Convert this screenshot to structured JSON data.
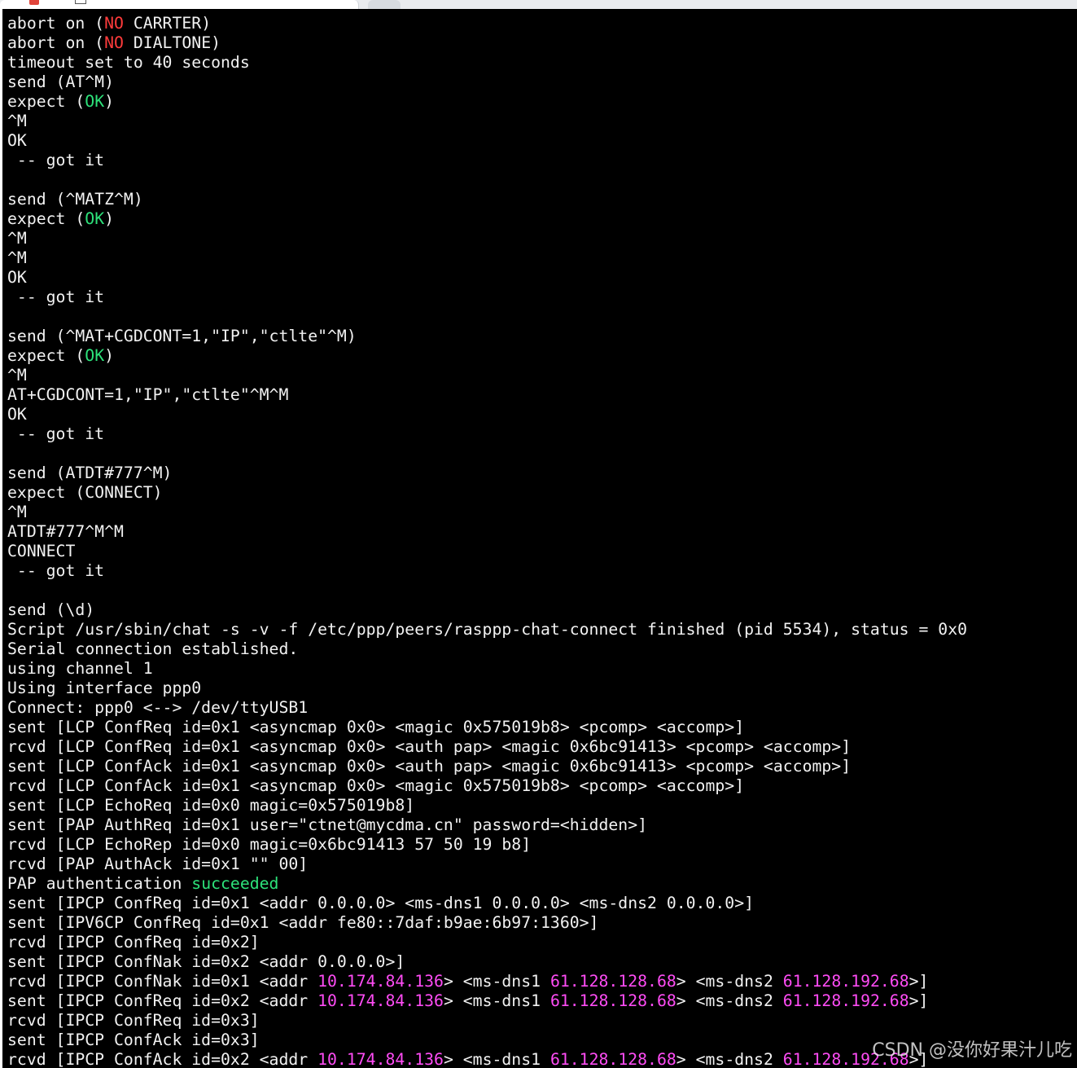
{
  "colors": {
    "terminal_bg": "#000000",
    "text": "#f2f2f2",
    "red": "#ff3b3b",
    "green": "#2de27a",
    "magenta": "#ff4cf5"
  },
  "terminal": {
    "lines": [
      [
        {
          "t": "abort on ("
        },
        {
          "t": "NO",
          "c": "red"
        },
        {
          "t": " CARRTER)"
        }
      ],
      [
        {
          "t": "abort on ("
        },
        {
          "t": "NO",
          "c": "red"
        },
        {
          "t": " DIALTONE)"
        }
      ],
      [
        {
          "t": "timeout set to 40 seconds"
        }
      ],
      [
        {
          "t": "send (AT^M)"
        }
      ],
      [
        {
          "t": "expect ("
        },
        {
          "t": "OK",
          "c": "green"
        },
        {
          "t": ")"
        }
      ],
      [
        {
          "t": "^M"
        }
      ],
      [
        {
          "t": "OK"
        }
      ],
      [
        {
          "t": " -- got it"
        }
      ],
      [
        {
          "t": ""
        }
      ],
      [
        {
          "t": "send (^MATZ^M)"
        }
      ],
      [
        {
          "t": "expect ("
        },
        {
          "t": "OK",
          "c": "green"
        },
        {
          "t": ")"
        }
      ],
      [
        {
          "t": "^M"
        }
      ],
      [
        {
          "t": "^M"
        }
      ],
      [
        {
          "t": "OK"
        }
      ],
      [
        {
          "t": " -- got it"
        }
      ],
      [
        {
          "t": ""
        }
      ],
      [
        {
          "t": "send (^MAT+CGDCONT=1,\"IP\",\"ctlte\"^M)"
        }
      ],
      [
        {
          "t": "expect ("
        },
        {
          "t": "OK",
          "c": "green"
        },
        {
          "t": ")"
        }
      ],
      [
        {
          "t": "^M"
        }
      ],
      [
        {
          "t": "AT+CGDCONT=1,\"IP\",\"ctlte\"^M^M"
        }
      ],
      [
        {
          "t": "OK"
        }
      ],
      [
        {
          "t": " -- got it"
        }
      ],
      [
        {
          "t": ""
        }
      ],
      [
        {
          "t": "send (ATDT#777^M)"
        }
      ],
      [
        {
          "t": "expect (CONNECT)"
        }
      ],
      [
        {
          "t": "^M"
        }
      ],
      [
        {
          "t": "ATDT#777^M^M"
        }
      ],
      [
        {
          "t": "CONNECT"
        }
      ],
      [
        {
          "t": " -- got it"
        }
      ],
      [
        {
          "t": ""
        }
      ],
      [
        {
          "t": "send (\\d)"
        }
      ],
      [
        {
          "t": "Script /usr/sbin/chat -s -v -f /etc/ppp/peers/rasppp-chat-connect finished (pid 5534), status = 0x0"
        }
      ],
      [
        {
          "t": "Serial connection established."
        }
      ],
      [
        {
          "t": "using channel 1"
        }
      ],
      [
        {
          "t": "Using interface ppp0"
        }
      ],
      [
        {
          "t": "Connect: ppp0 <--> /dev/ttyUSB1"
        }
      ],
      [
        {
          "t": "sent [LCP ConfReq id=0x1 <asyncmap 0x0> <magic 0x575019b8> <pcomp> <accomp>]"
        }
      ],
      [
        {
          "t": "rcvd [LCP ConfReq id=0x1 <asyncmap 0x0> <auth pap> <magic 0x6bc91413> <pcomp> <accomp>]"
        }
      ],
      [
        {
          "t": "sent [LCP ConfAck id=0x1 <asyncmap 0x0> <auth pap> <magic 0x6bc91413> <pcomp> <accomp>]"
        }
      ],
      [
        {
          "t": "rcvd [LCP ConfAck id=0x1 <asyncmap 0x0> <magic 0x575019b8> <pcomp> <accomp>]"
        }
      ],
      [
        {
          "t": "sent [LCP EchoReq id=0x0 magic=0x575019b8]"
        }
      ],
      [
        {
          "t": "sent [PAP AuthReq id=0x1 user=\"ctnet@mycdma.cn\" password=<hidden>]"
        }
      ],
      [
        {
          "t": "rcvd [LCP EchoRep id=0x0 magic=0x6bc91413 57 50 19 b8]"
        }
      ],
      [
        {
          "t": "rcvd [PAP AuthAck id=0x1 \"\" 00]"
        }
      ],
      [
        {
          "t": "PAP authentication "
        },
        {
          "t": "succeeded",
          "c": "green"
        }
      ],
      [
        {
          "t": "sent [IPCP ConfReq id=0x1 <addr 0.0.0.0> <ms-dns1 0.0.0.0> <ms-dns2 0.0.0.0>]"
        }
      ],
      [
        {
          "t": "sent [IPV6CP ConfReq id=0x1 <addr fe80::7daf:b9ae:6b97:1360>]"
        }
      ],
      [
        {
          "t": "rcvd [IPCP ConfReq id=0x2]"
        }
      ],
      [
        {
          "t": "sent [IPCP ConfNak id=0x2 <addr 0.0.0.0>]"
        }
      ],
      [
        {
          "t": "rcvd [IPCP ConfNak id=0x1 <addr "
        },
        {
          "t": "10.174.84.136",
          "c": "magenta"
        },
        {
          "t": "> <ms-dns1 "
        },
        {
          "t": "61.128.128.68",
          "c": "magenta"
        },
        {
          "t": "> <ms-dns2 "
        },
        {
          "t": "61.128.192.68",
          "c": "magenta"
        },
        {
          "t": ">]"
        }
      ],
      [
        {
          "t": "sent [IPCP ConfReq id=0x2 <addr "
        },
        {
          "t": "10.174.84.136",
          "c": "magenta"
        },
        {
          "t": "> <ms-dns1 "
        },
        {
          "t": "61.128.128.68",
          "c": "magenta"
        },
        {
          "t": "> <ms-dns2 "
        },
        {
          "t": "61.128.192.68",
          "c": "magenta"
        },
        {
          "t": ">]"
        }
      ],
      [
        {
          "t": "rcvd [IPCP ConfReq id=0x3]"
        }
      ],
      [
        {
          "t": "sent [IPCP ConfAck id=0x3]"
        }
      ],
      [
        {
          "t": "rcvd [IPCP ConfAck id=0x2 <addr "
        },
        {
          "t": "10.174.84.136",
          "c": "magenta"
        },
        {
          "t": "> <ms-dns1 "
        },
        {
          "t": "61.128.128.68",
          "c": "magenta"
        },
        {
          "t": "> <ms-dns2 "
        },
        {
          "t": "61.128.192.68",
          "c": "magenta"
        },
        {
          "t": ">]"
        }
      ]
    ]
  },
  "watermark": "CSDN @没你好果汁儿吃"
}
